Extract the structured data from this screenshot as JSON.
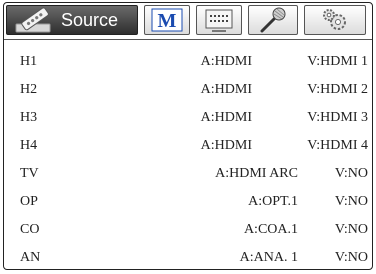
{
  "tabs": [
    {
      "label": "Source",
      "icon": "remote-control-icon",
      "active": true
    },
    {
      "label": "",
      "icon": "m-logo-icon",
      "active": false
    },
    {
      "label": "",
      "icon": "display-screen-icon",
      "active": false
    },
    {
      "label": "",
      "icon": "microphone-icon",
      "active": false
    },
    {
      "label": "",
      "icon": "gears-icon",
      "active": false
    }
  ],
  "accent_color": "#1a4bb0",
  "sources": [
    {
      "name": "H1",
      "audio": "A:HDMI",
      "video": "V:HDMI 1"
    },
    {
      "name": "H2",
      "audio": "A:HDMI",
      "video": "V:HDMI 2"
    },
    {
      "name": "H3",
      "audio": "A:HDMI",
      "video": "V:HDMI 3"
    },
    {
      "name": "H4",
      "audio": "A:HDMI",
      "video": "V:HDMI 4"
    },
    {
      "name": "TV",
      "audio": "A:HDMI ARC",
      "video": "V:NO"
    },
    {
      "name": "OP",
      "audio": "A:OPT.1",
      "video": "V:NO"
    },
    {
      "name": "CO",
      "audio": "A:COA.1",
      "video": "V:NO"
    },
    {
      "name": "AN",
      "audio": "A:ANA. 1",
      "video": "V:NO"
    }
  ]
}
